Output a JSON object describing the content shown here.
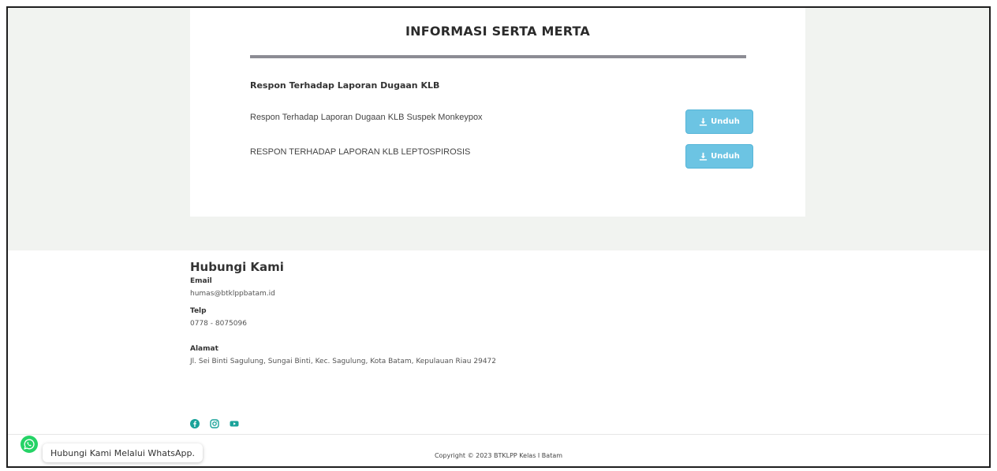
{
  "page": {
    "title": "INFORMASI SERTA MERTA",
    "section_heading": "Respon Terhadap Laporan Dugaan KLB"
  },
  "documents": [
    {
      "title": "Respon Terhadap Laporan Dugaan KLB Suspek Monkeypox",
      "button_label": "Unduh"
    },
    {
      "title": "RESPON TERHADAP LAPORAN KLB LEPTOSPIROSIS",
      "button_label": "Unduh"
    }
  ],
  "footer": {
    "contact_title": "Hubungi Kami",
    "email_label": "Email",
    "email_value": "humas@btklppbatam.id",
    "telp_label": "Telp",
    "telp_value": "0778 - 8075096",
    "alamat_label": "Alamat",
    "alamat_value": "Jl. Sei Binti Sagulung, Sungai Binti, Kec. Sagulung, Kota Batam, Kepulauan Riau 29472",
    "social_icons": [
      "facebook-icon",
      "instagram-icon",
      "youtube-icon"
    ],
    "copyright": "Copyright © 2023 BTKLPP Kelas I Batam"
  },
  "whatsapp": {
    "label": "Hubungi Kami Melalui WhatsApp."
  },
  "colors": {
    "page_background": "#f1f3f0",
    "button": "#6cc4e3",
    "accent_teal": "#1aa39a",
    "whatsapp": "#25d366",
    "title_rule": "#8c8c94"
  }
}
